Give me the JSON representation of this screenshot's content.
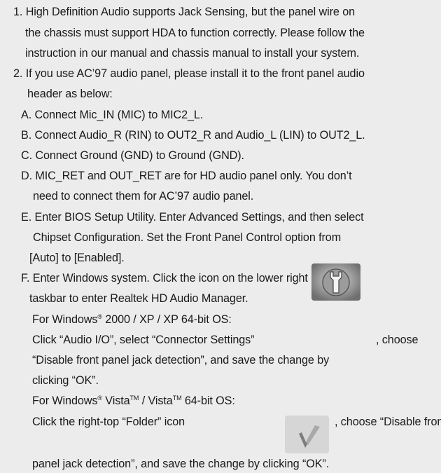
{
  "lines": [
    "1. High Definition Audio supports Jack Sensing, but the panel wire on",
    "the chassis must support HDA to function correctly. Please follow the",
    "instruction in our manual and chassis manual to install your system.",
    "2. If you use AC’97 audio panel, please install it to the front panel audio",
    "header as below:",
    "A. Connect Mic_IN (MIC) to MIC2_L.",
    "B. Connect Audio_R (RIN) to OUT2_R and Audio_L (LIN) to OUT2_L.",
    "C. Connect Ground (GND) to Ground (GND).",
    "D. MIC_RET and OUT_RET are for HD audio panel only. You don’t",
    "need to connect them for AC’97 audio panel.",
    "E. Enter BIOS Setup Utility. Enter Advanced Settings, and then select",
    "Chipset Configuration. Set the Front Panel Control option from",
    "[Auto] to [Enabled].",
    "F. Enter Windows system. Click the icon on the lower right hand",
    "taskbar to enter Realtek HD Audio Manager.",
    "For Windows",
    "Click “Audio I/O”, select “Connector Settings”",
    "“Disable front panel jack detection”, and save the change by",
    "clicking “OK”.",
    "For Windows",
    "Click the right-top “Folder” icon",
    "panel jack detection”, and save the change by clicking “OK”."
  ],
  "line16": {
    "sup": "®",
    "rest": " 2000 / XP / XP 64-bit OS:"
  },
  "line17_after": ", choose",
  "line20": {
    "sup1": "®",
    "mid": " Vista",
    "sup2": "TM",
    "mid2": " / Vista",
    "sup3": "TM",
    "rest": " 64-bit OS:"
  },
  "line21_after": ", choose “Disable front",
  "icons": {
    "connector_settings": "wrench-icon",
    "folder": "folder-icon"
  }
}
